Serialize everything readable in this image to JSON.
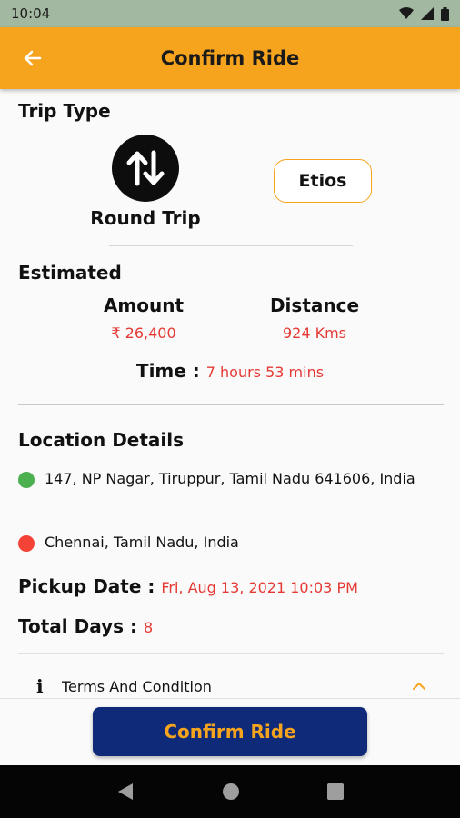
{
  "status_bar": {
    "time": "10:04"
  },
  "app_bar": {
    "title": "Confirm Ride"
  },
  "trip_type": {
    "heading": "Trip Type",
    "label": "Round Trip",
    "car": "Etios"
  },
  "estimated": {
    "heading": "Estimated",
    "amount_label": "Amount",
    "amount_value": "₹ 26,400",
    "distance_label": "Distance",
    "distance_value": "924 Kms",
    "time_label": "Time :",
    "time_value": "7 hours 53 mins"
  },
  "location": {
    "heading": "Location Details",
    "pickup": "147, NP Nagar, Tiruppur, Tamil Nadu 641606, India",
    "drop": "Chennai, Tamil Nadu, India"
  },
  "pickup_date": {
    "label": "Pickup Date :",
    "value": "Fri, Aug 13, 2021 10:03 PM"
  },
  "total_days": {
    "label": "Total Days :",
    "value": "8"
  },
  "terms": {
    "label": "Terms And Condition"
  },
  "confirm_button": {
    "label": "Confirm Ride"
  },
  "colors": {
    "accent": "#f6a41e",
    "primary": "#0f2a78",
    "value": "#e53935",
    "pickup_dot": "#4caf50",
    "drop_dot": "#f44336"
  }
}
